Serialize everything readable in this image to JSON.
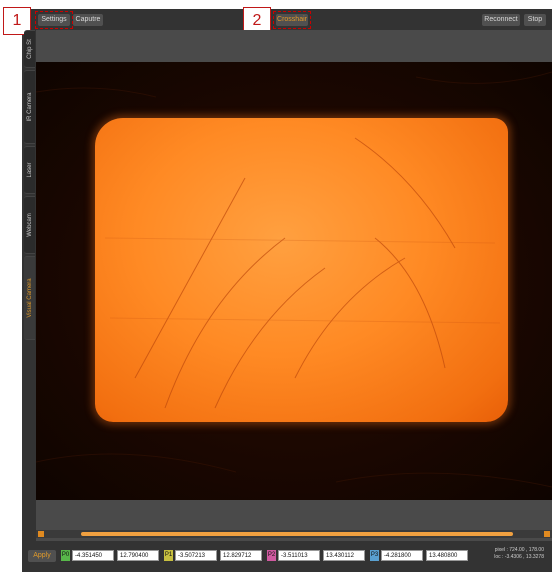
{
  "toolbar": {
    "settings_label": "Settings",
    "capture_label": "Caputre",
    "crosshair_label": "Crosshair",
    "reconnect_label": "Reconnect",
    "stop_label": "Stop"
  },
  "callouts": {
    "one": "1",
    "two": "2"
  },
  "side_tabs": [
    {
      "label": "Chip St"
    },
    {
      "label": "IR Camera"
    },
    {
      "label": "Laser"
    },
    {
      "label": "Webcam"
    },
    {
      "label": "Visual Camera"
    }
  ],
  "points": {
    "apply_label": "Apply",
    "p0": {
      "tag": "P0",
      "x": "-4.351450",
      "y": "12.790400",
      "color": "#58b84a"
    },
    "p1": {
      "tag": "P1",
      "x": "-3.507213",
      "y": "12.829712",
      "color": "#c8c040"
    },
    "p2": {
      "tag": "P2",
      "x": "-3.511013",
      "y": "13.430112",
      "color": "#d05aa0"
    },
    "p3": {
      "tag": "P3",
      "x": "-4.281800",
      "y": "13.480800",
      "color": "#5aa0d0"
    }
  },
  "info": {
    "pixel": "pixel : 724.00 , 178.00",
    "loc": "loc : -3.4306 , 13.3278"
  },
  "colors": {
    "accent": "#e09a2a",
    "highlight": "#cc0000"
  }
}
